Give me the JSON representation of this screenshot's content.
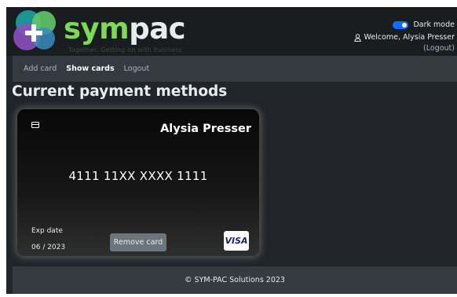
{
  "header": {
    "brand_part1": "sym",
    "brand_part2": "pac",
    "tagline": "Together. Getting on with business",
    "dark_mode_label": "Dark mode",
    "dark_mode_on": true,
    "welcome_text": "Welcome, Alysia Presser",
    "logout_label": "Logout"
  },
  "nav": {
    "items": [
      {
        "label": "Add card",
        "active": false
      },
      {
        "label": "Show cards",
        "active": true
      },
      {
        "label": "Logout",
        "active": false
      }
    ]
  },
  "main": {
    "title": "Current payment methods",
    "card": {
      "holder": "Alysia Presser",
      "number": "4111 11XX XXXX 1111",
      "exp_label": "Exp date",
      "exp_value": "06 / 2023",
      "remove_label": "Remove card",
      "brand": "VISA",
      "chip_icon": "credit-card-icon"
    }
  },
  "footer": {
    "text": "© SYM-PAC Solutions 2023"
  },
  "colors": {
    "brand_green": "#7ed957",
    "accent_blue": "#0d6efd",
    "logo_purple": "#8b4fbf",
    "logo_teal": "#1a9b9b",
    "logo_green": "#62c66a"
  }
}
